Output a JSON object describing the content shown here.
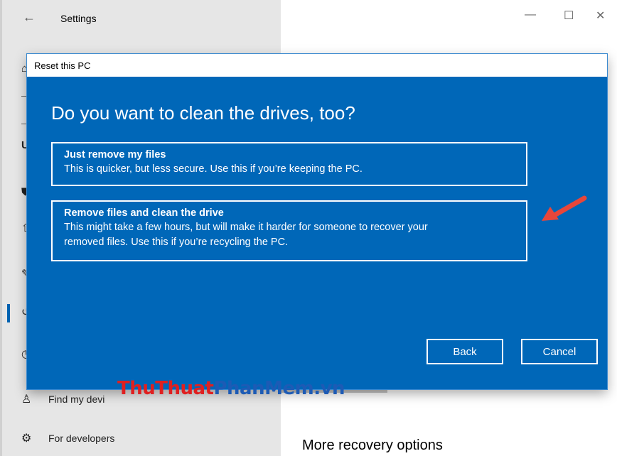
{
  "settings": {
    "title": "Settings",
    "back_icon": "←",
    "window_controls": {
      "minimize": "—",
      "maximize": "☐",
      "close": "✕"
    },
    "fragments": [
      "U"
    ],
    "nav": [
      {
        "label": "Find my devi",
        "icon": "find-device-icon",
        "glyph": "♙"
      },
      {
        "label": "For developers",
        "icon": "developers-icon",
        "glyph": "⚙"
      }
    ],
    "more_recovery": "More recovery options"
  },
  "dialog": {
    "title": "Reset this PC",
    "heading": "Do you want to clean the drives, too?",
    "options": [
      {
        "title": "Just remove my files",
        "description": "This is quicker, but less secure. Use this if you’re keeping the PC."
      },
      {
        "title": "Remove files and clean the drive",
        "description_line1": "This might take a few hours, but will make it harder for someone to recover your",
        "description_line2": "removed files. Use this if you’re recycling the PC."
      }
    ],
    "buttons": {
      "back": "Back",
      "cancel": "Cancel"
    },
    "colors": {
      "background": "#0067b8",
      "text": "#ffffff"
    }
  },
  "annotation": {
    "arrow_color": "#e8463a",
    "arrow_icon": "arrow-pointer-icon"
  },
  "watermark": {
    "part1": "ThuThuat",
    "part2": "PhanMem.vn",
    "color1": "#e02020",
    "color2": "#1d5bb5"
  }
}
